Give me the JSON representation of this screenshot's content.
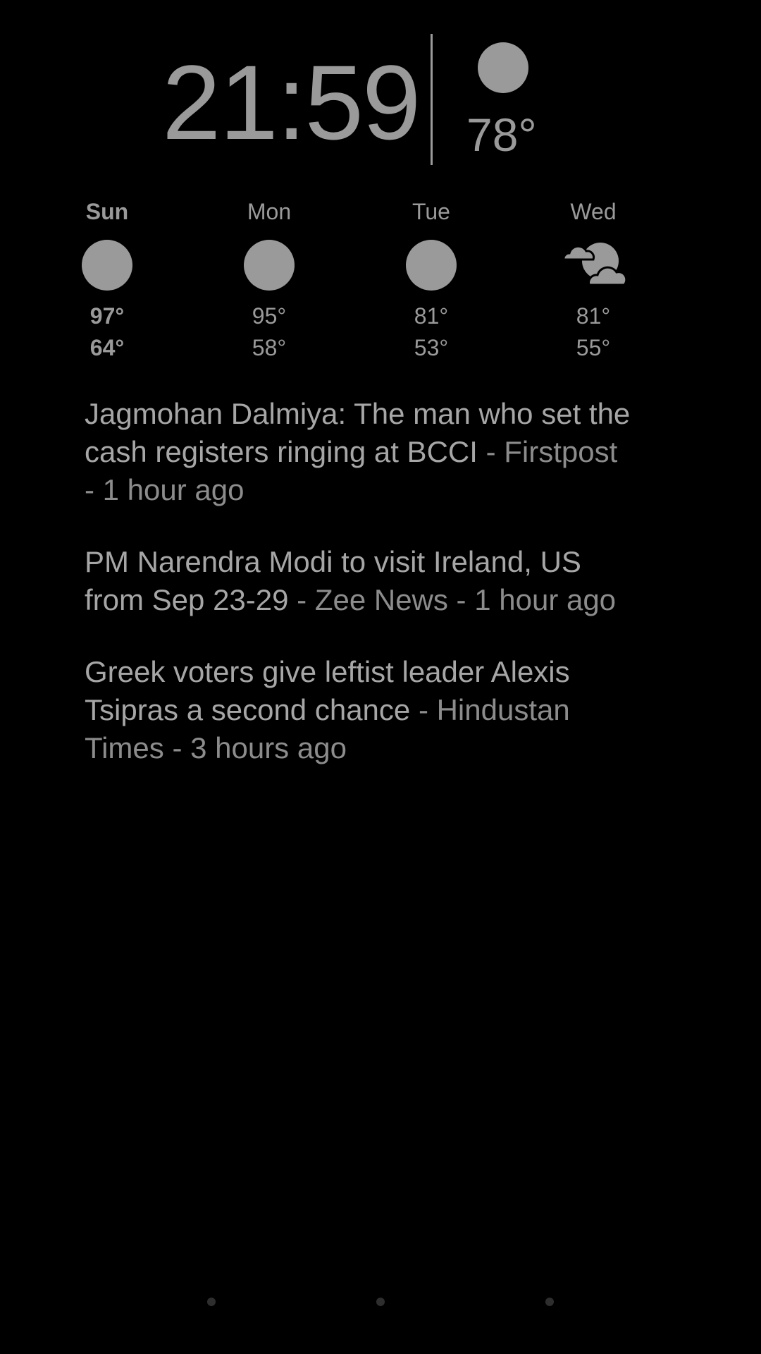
{
  "clock": {
    "time": "21:59",
    "current_temp": "78°",
    "current_icon": "sun-icon"
  },
  "forecast": [
    {
      "day": "Sun",
      "icon": "sun-icon",
      "high": "97°",
      "low": "64°",
      "highlight": true
    },
    {
      "day": "Mon",
      "icon": "sun-icon",
      "high": "95°",
      "low": "58°",
      "highlight": false
    },
    {
      "day": "Tue",
      "icon": "sun-icon",
      "high": "81°",
      "low": "53°",
      "highlight": false
    },
    {
      "day": "Wed",
      "icon": "partly-cloudy-icon",
      "high": "81°",
      "low": "55°",
      "highlight": false
    }
  ],
  "news": [
    {
      "headline": "Jagmohan Dalmiya: The man who set the cash registers ringing at BCCI",
      "source": " - Firstpost - 1 hour ago"
    },
    {
      "headline": "PM Narendra Modi to visit Ireland, US from Sep 23-29",
      "source": " - Zee News - 1 hour ago"
    },
    {
      "headline": "Greek voters give leftist leader Alexis Tsipras a second chance",
      "source": " - Hindustan Times - 3 hours ago"
    }
  ],
  "pager": {
    "page_count": 3,
    "current_page": 2
  },
  "colors": {
    "background": "#000000",
    "foreground": "#9a9a9a"
  }
}
